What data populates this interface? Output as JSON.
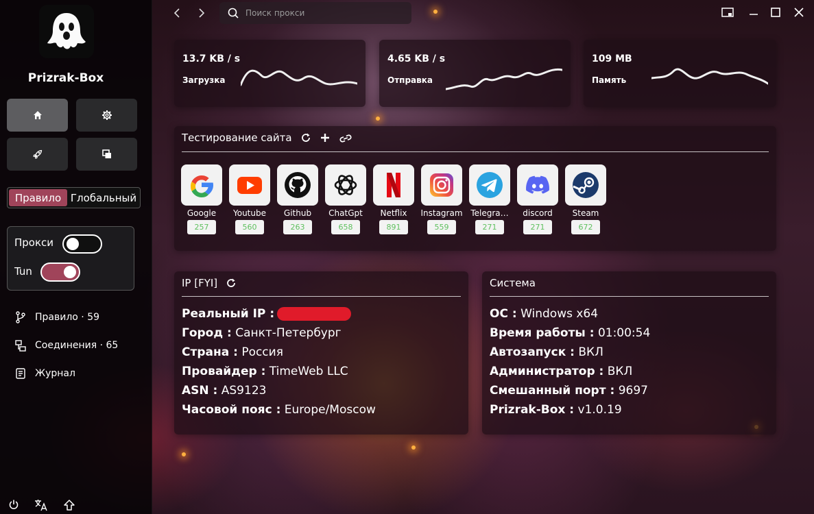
{
  "app": {
    "name": "Prizrak-Box"
  },
  "sidebar": {
    "mode": {
      "rule": "Правило",
      "global": "Глобальный"
    },
    "proxy_label": "Прокси",
    "tun_label": "Tun",
    "links": [
      {
        "label": "Правило · 59",
        "icon": "branch-icon"
      },
      {
        "label": "Соединения · 65",
        "icon": "connections-icon"
      },
      {
        "label": "Журнал",
        "icon": "log-icon"
      }
    ],
    "toggles": {
      "proxy": false,
      "tun": true
    }
  },
  "topbar": {
    "search_placeholder": "Поиск прокси"
  },
  "stats": {
    "download": {
      "value": "13.7 KB / s",
      "label": "Загрузка"
    },
    "upload": {
      "value": "4.65 KB / s",
      "label": "Отправка"
    },
    "memory": {
      "value": "109 MB",
      "label": "Память"
    }
  },
  "site_test": {
    "title": "Тестирование сайта",
    "sites": [
      {
        "name": "Google",
        "ms": "257"
      },
      {
        "name": "Youtube",
        "ms": "560"
      },
      {
        "name": "Github",
        "ms": "263"
      },
      {
        "name": "ChatGpt",
        "ms": "658"
      },
      {
        "name": "Netflix",
        "ms": "891"
      },
      {
        "name": "Instagram",
        "ms": "559"
      },
      {
        "name": "Telegra…",
        "ms": "271"
      },
      {
        "name": "discord",
        "ms": "271"
      },
      {
        "name": "Steam",
        "ms": "672"
      }
    ]
  },
  "ip_card": {
    "title": "IP [FYI]",
    "rows": [
      {
        "key": "Реальный IP :",
        "value": ""
      },
      {
        "key": "Город :",
        "value": "Санкт-Петербург"
      },
      {
        "key": "Страна :",
        "value": "Россия"
      },
      {
        "key": "Провайдер :",
        "value": "TimeWeb LLC"
      },
      {
        "key": "ASN :",
        "value": "AS9123"
      },
      {
        "key": "Часовой пояс :",
        "value": "Europe/Moscow"
      }
    ]
  },
  "system_card": {
    "title": "Система",
    "rows": [
      {
        "key": "ОС :",
        "value": "Windows x64"
      },
      {
        "key": "Время работы :",
        "value": "01:00:54"
      },
      {
        "key": "Автозапуск :",
        "value": "ВКЛ"
      },
      {
        "key": "Администратор :",
        "value": "ВКЛ"
      },
      {
        "key": "Смешанный порт :",
        "value": "9697"
      },
      {
        "key": "Prizrak-Box :",
        "value": "v1.0.19"
      }
    ]
  },
  "colors": {
    "accent": "#a0445a",
    "latency_good": "#5fc05f"
  }
}
